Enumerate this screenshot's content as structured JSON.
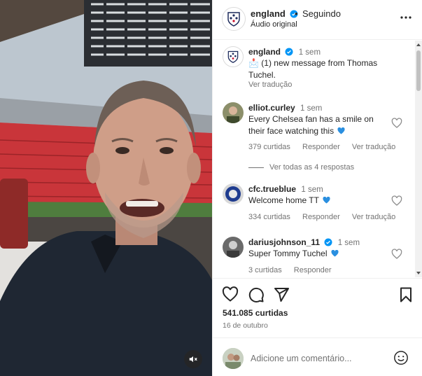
{
  "media": {
    "mute_icon": "speaker-muted-icon"
  },
  "header": {
    "username": "england",
    "separator": "•",
    "follow_status": "Seguindo",
    "audio": "Áudio original",
    "more_icon": "more-horizontal-icon"
  },
  "caption": {
    "username": "england",
    "time": "1 sem",
    "text": "📩 (1) new message from Thomas Tuchel.",
    "translate": "Ver tradução"
  },
  "comments": [
    {
      "username": "elliot.curley",
      "time": "1 sem",
      "text": "Every Chelsea fan has a smile on their face watching this",
      "likes": "379 curtidas",
      "reply": "Responder",
      "translate": "Ver tradução",
      "view_replies": "Ver todas as 4 respostas"
    },
    {
      "username": "cfc.trueblue",
      "time": "1 sem",
      "text": "Welcome home TT",
      "likes": "334 curtidas",
      "reply": "Responder",
      "translate": "Ver tradução"
    },
    {
      "username": "dariusjohnson_11",
      "time": "1 sem",
      "text": "Super Tommy Tuchel",
      "likes": "3 curtidas",
      "reply": "Responder"
    }
  ],
  "actions": {
    "like_icon": "heart-outline-icon",
    "comment_icon": "comment-icon",
    "share_icon": "send-icon",
    "save_icon": "bookmark-icon",
    "likes": "541.085 curtidas",
    "date": "16 de outubro"
  },
  "add_comment": {
    "placeholder": "Adicione um comentário...",
    "emoji_icon": "emoji-smile-icon"
  },
  "colors": {
    "verified": "#0095f6",
    "blue_heart": "#2a8fe0",
    "text_primary": "#262626",
    "text_secondary": "#737373",
    "divider": "#efefef"
  }
}
